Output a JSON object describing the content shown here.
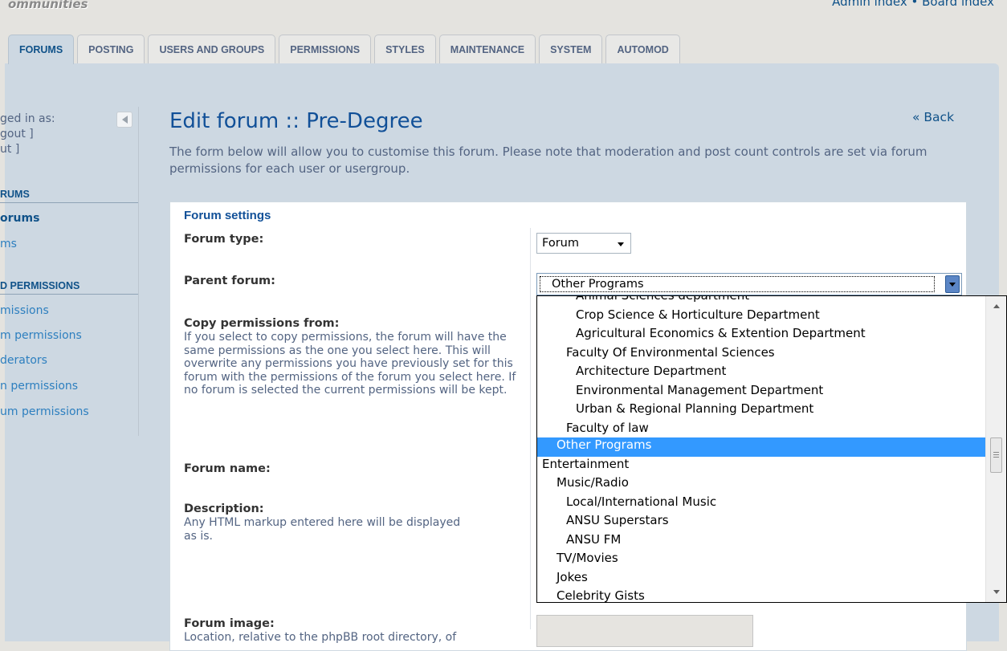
{
  "header": {
    "site_title": "ommunities",
    "top_links": "Admin index • Board index"
  },
  "tabs": [
    {
      "label": "FORUMS",
      "active": true
    },
    {
      "label": "POSTING"
    },
    {
      "label": "USERS AND GROUPS"
    },
    {
      "label": "PERMISSIONS"
    },
    {
      "label": "STYLES"
    },
    {
      "label": "MAINTENANCE"
    },
    {
      "label": "SYSTEM"
    },
    {
      "label": "AUTOMOD"
    }
  ],
  "sidebar": {
    "login": {
      "line1": "ged in as:",
      "line2": "gout ]",
      "line3": "ut ]"
    },
    "section_forums": "RUMS",
    "manage_forums": "orums",
    "forums_item": "ms",
    "section_permissions": "D PERMISSIONS",
    "perm_items": [
      "missions",
      "m permissions",
      "derators",
      "n permissions",
      "um permissions"
    ]
  },
  "main": {
    "title": "Edit forum :: Pre-Degree",
    "back": "« Back",
    "intro": "The form below will allow you to customise this forum. Please note that moderation and post count controls are set via forum permissions for each user or usergroup."
  },
  "form": {
    "legend": "Forum settings",
    "forum_type_label": "Forum type:",
    "forum_type_value": "Forum",
    "parent_label": "Parent forum:",
    "parent_value": "Other Programs",
    "copy_label": "Copy permissions from:",
    "copy_explain": "If you select to copy permissions, the forum will have the same permissions as the one you select here. This will overwrite any permissions you have previously set for this forum with the permissions of the forum you select here. If no forum is selected the current permissions will be kept.",
    "name_label": "Forum name:",
    "desc_label": "Description:",
    "desc_explain": "Any HTML markup entered here will be displayed as is.",
    "image_label": "Forum image:",
    "image_explain": "Location, relative to the phpBB root directory, of"
  },
  "parent_options": [
    {
      "label": "Animal Sciences department",
      "level": 4
    },
    {
      "label": "Crop Science & Horticulture Department",
      "level": 4
    },
    {
      "label": "Agricultural Economics & Extention Department",
      "level": 4
    },
    {
      "label": "Faculty Of Environmental Sciences",
      "level": 3
    },
    {
      "label": "Architecture Department",
      "level": 4
    },
    {
      "label": "Environmental Management Department",
      "level": 4
    },
    {
      "label": "Urban & Regional Planning Department",
      "level": 4
    },
    {
      "label": "Faculty of law",
      "level": 3
    },
    {
      "label": "Other Programs",
      "level": 2,
      "selected": true
    },
    {
      "label": "Entertainment",
      "level": 0
    },
    {
      "label": "Music/Radio",
      "level": 1
    },
    {
      "label": "Local/International Music",
      "level": 2
    },
    {
      "label": "ANSU Superstars",
      "level": 2
    },
    {
      "label": "ANSU FM",
      "level": 2
    },
    {
      "label": "TV/Movies",
      "level": 1
    },
    {
      "label": "Jokes",
      "level": 1
    },
    {
      "label": "Celebrity Gists",
      "level": 1
    }
  ],
  "colors": {
    "page_bg": "#e4e3df",
    "panel_bg": "#cdd8e2",
    "heading_blue": "#115098",
    "link_blue": "#105289",
    "selection_blue": "#3399ff"
  }
}
